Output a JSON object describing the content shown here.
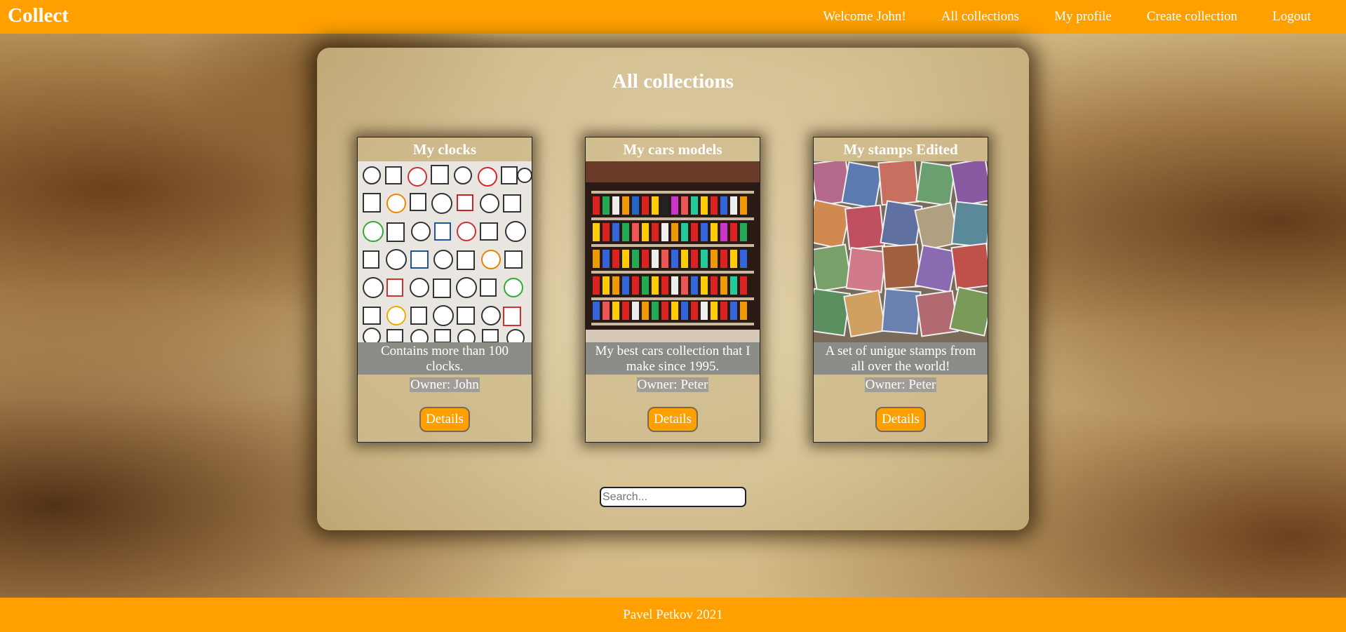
{
  "nav": {
    "brand": "Collect",
    "welcome": "Welcome John!",
    "links": [
      "All collections",
      "My profile",
      "Create collection",
      "Logout"
    ]
  },
  "main": {
    "title": "All collections",
    "cards": [
      {
        "title": "My clocks",
        "description": "Contains more than 100 clocks.",
        "owner": "Owner: John",
        "button": "Details"
      },
      {
        "title": "My cars models",
        "description": "My best cars collection that I make since 1995.",
        "owner": "Owner: Peter",
        "button": "Details"
      },
      {
        "title": "My stamps Edited",
        "description": "A set of unigue stamps from all over the world!",
        "owner": "Owner: Peter",
        "button": "Details"
      }
    ],
    "search": {
      "placeholder": "Search...",
      "value": ""
    }
  },
  "footer": {
    "text": "Pavel Petkov 2021"
  },
  "colors": {
    "accent": "#ffa000",
    "text_light": "#ffffff",
    "desc_bg": "#8c8c87"
  }
}
